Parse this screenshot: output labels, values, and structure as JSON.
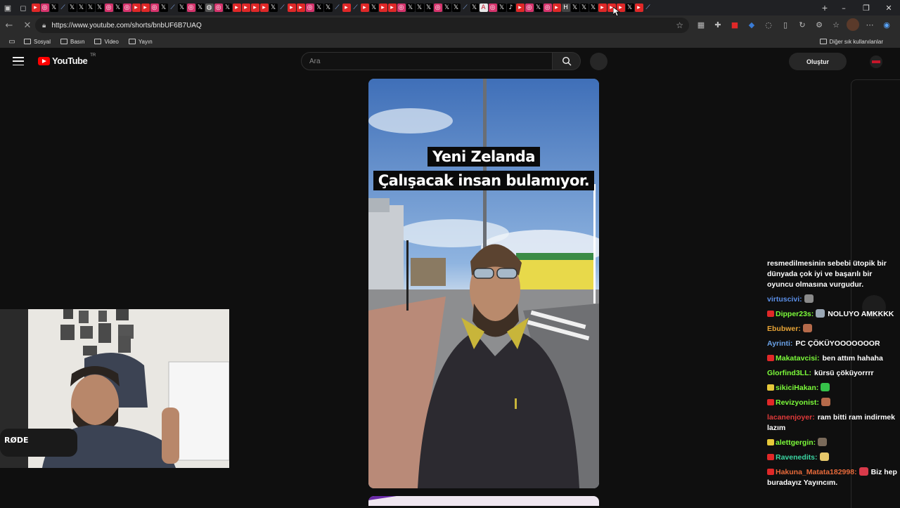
{
  "browser": {
    "url": "https://www.youtube.com/shorts/bnbUF6B7UAQ",
    "bookmarks": [
      "Sosyal",
      "Basın",
      "Video",
      "Yayın"
    ],
    "bookmarks_other": "Diğer sık kullanılanlar",
    "tab_icons": [
      "yt-tab",
      "ig-tab",
      "x-tab",
      "link-tab",
      "x-tab",
      "x-tab",
      "x-tab",
      "x-tab",
      "ig-tab",
      "x-tab",
      "ig-tab",
      "yt-tab",
      "yt-tab",
      "ig-tab",
      "x-tab",
      "link-tab",
      "x-tab",
      "ig-tab",
      "x-tab",
      "globe-tab",
      "ig-tab",
      "x-tab",
      "yt-tab",
      "yt-tab",
      "yt-tab",
      "yt-tab",
      "x-tab",
      "link-tab",
      "yt-tab",
      "yt-tab",
      "ig-tab",
      "x-tab",
      "x-tab",
      "link-tab",
      "yt-tab",
      "link-tab",
      "yt-tab",
      "x-tab",
      "yt-tab",
      "yt-tab",
      "ig-tab",
      "x-tab",
      "x-tab",
      "x-tab",
      "ig-tab",
      "x-tab",
      "x-tab",
      "link-tab",
      "x-tab",
      "active-tab",
      "ig-tab",
      "x-tab",
      "tiktok-tab",
      "yt-tab",
      "ig-tab",
      "x-tab",
      "ig-tab",
      "yt-tab",
      "h-tab",
      "x-tab",
      "x-tab",
      "x-tab",
      "yt-tab",
      "yt-tab",
      "yt-tab",
      "x-tab",
      "yt-tab",
      "link-tab"
    ]
  },
  "youtube": {
    "logo_text": "YouTube",
    "region": "TR",
    "search_placeholder": "Ara",
    "create_label": "Oluştur"
  },
  "short": {
    "caption_line1": "Yeni Zelanda",
    "caption_line2": "Çalışacak insan bulamıyor."
  },
  "chat": {
    "messages": [
      {
        "user": "",
        "text": "resmedilmesinin sebebi ütopik bir dünyada çok iyi ve başarılı bir oyuncu olmasına vurgudur.",
        "color": "#ffffff",
        "badge": "",
        "emote": ""
      },
      {
        "user": "virtuscivi:",
        "text": "",
        "color": "#5b8fe8",
        "badge": "",
        "emote": "#8a8a8a"
      },
      {
        "user": "Dipper23s:",
        "text": "NOLUYO AMKKKK",
        "color": "#7cfc3a",
        "badge": "#e02828",
        "emote": "#9aa7b5"
      },
      {
        "user": "Ebubwer:",
        "text": "",
        "color": "#e8a436",
        "badge": "",
        "emote": "#b56a4a"
      },
      {
        "user": "Ayrinti:",
        "text": "PC ÇÖKÜYOOOOOOOR",
        "color": "#6aa2e8",
        "badge": "",
        "emote": ""
      },
      {
        "user": "Makatavcisi:",
        "text": "ben attım hahaha",
        "color": "#7cfc3a",
        "badge": "#e02828",
        "emote": ""
      },
      {
        "user": "Glorfind3LL:",
        "text": "kürsü çöküyorrrr",
        "color": "#7cfc3a",
        "badge": "",
        "emote": ""
      },
      {
        "user": "sikiciHakan:",
        "text": "",
        "color": "#7cfc3a",
        "badge": "#e6c83a",
        "emote": "#36c24a"
      },
      {
        "user": "Revizyonist:",
        "text": "",
        "color": "#7cfc3a",
        "badge": "#e02828",
        "emote": "#b56a4a"
      },
      {
        "user": "lacanenjoyer:",
        "text": "ram bitti ram indirmek lazım",
        "color": "#e03a3a",
        "badge": "",
        "emote": ""
      },
      {
        "user": "alettgergin:",
        "text": "",
        "color": "#7cfc3a",
        "badge": "#e6c83a",
        "emote": "#7a6a5a"
      },
      {
        "user": "Ravenedits:",
        "text": "",
        "color": "#3ad6a2",
        "badge": "#e02828",
        "emote": "#e6c86a"
      },
      {
        "user": "Hakuna_Matata182998:",
        "text": "Biz hep buradayız Yayıncım.",
        "color": "#e86a3a",
        "badge": "#e02828",
        "emote": "#d83a4a"
      }
    ]
  },
  "colors": {
    "page_bg": "#0f0f0f",
    "yt_red": "#ff0000",
    "browser_bg": "#2b2b2b"
  }
}
